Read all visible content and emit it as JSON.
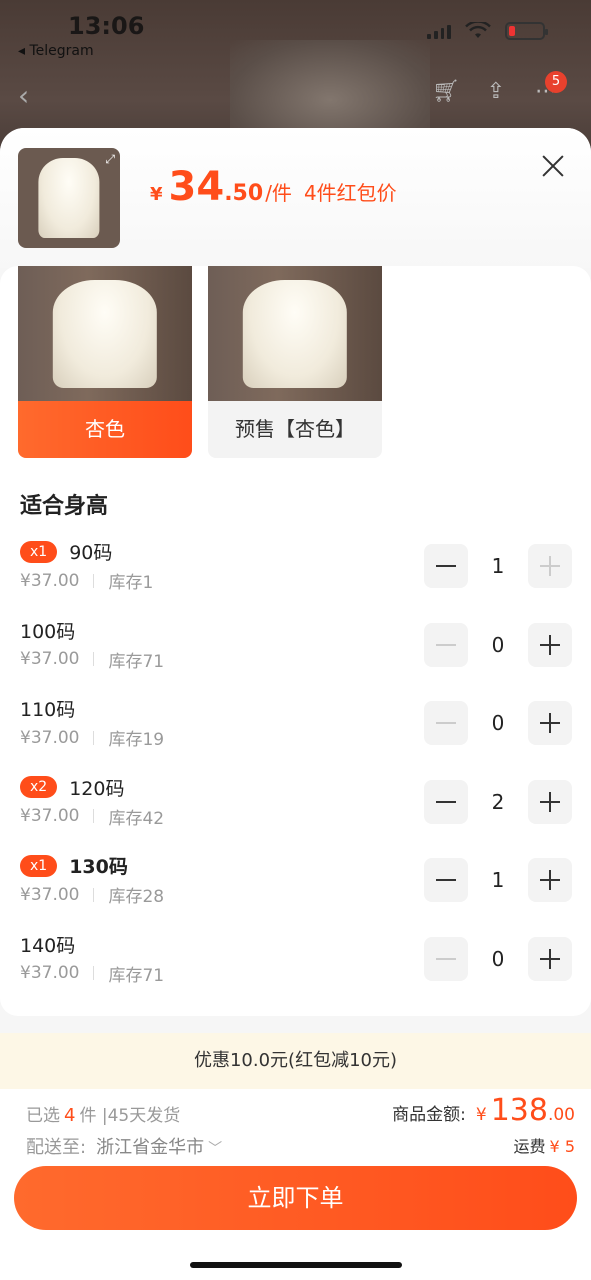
{
  "status": {
    "time": "13:06",
    "back_app": "◂ Telegram"
  },
  "nav": {
    "cart_count": "5"
  },
  "header": {
    "yen": "¥",
    "price_int": "34",
    "price_dec": ".50",
    "unit": "/件",
    "promo": "4件红包价"
  },
  "sku_options": [
    {
      "label": "杏色",
      "selected": true
    },
    {
      "label": "预售【杏色】",
      "selected": false
    }
  ],
  "sizes_title": "适合身高",
  "sizes": [
    {
      "name": "90码",
      "badge": "x1",
      "price": "¥37.00",
      "stock": "库存1",
      "qty": "1",
      "bold": false
    },
    {
      "name": "100码",
      "badge": "",
      "price": "¥37.00",
      "stock": "库存71",
      "qty": "0",
      "bold": false
    },
    {
      "name": "110码",
      "badge": "",
      "price": "¥37.00",
      "stock": "库存19",
      "qty": "0",
      "bold": false
    },
    {
      "name": "120码",
      "badge": "x2",
      "price": "¥37.00",
      "stock": "库存42",
      "qty": "2",
      "bold": false
    },
    {
      "name": "130码",
      "badge": "x1",
      "price": "¥37.00",
      "stock": "库存28",
      "qty": "1",
      "bold": true
    },
    {
      "name": "140码",
      "badge": "",
      "price": "¥37.00",
      "stock": "库存71",
      "qty": "0",
      "bold": false
    }
  ],
  "discount_text": "优惠10.0元(红包减10元)",
  "footer": {
    "selected_prefix": "已选",
    "selected_count": "4",
    "selected_suffix": "件 |45天发货",
    "ship_label": "配送至:",
    "ship_city": "浙江省金华市",
    "amount_label": "商品金额:",
    "amount_yen": "¥",
    "amount_int": "138",
    "amount_dec": ".00",
    "freight_label": "运费",
    "freight_value": "¥ 5",
    "order_button": "立即下单"
  },
  "colors": {
    "accent": "#ff4d1a",
    "discount_bg": "#fdf7e6"
  }
}
